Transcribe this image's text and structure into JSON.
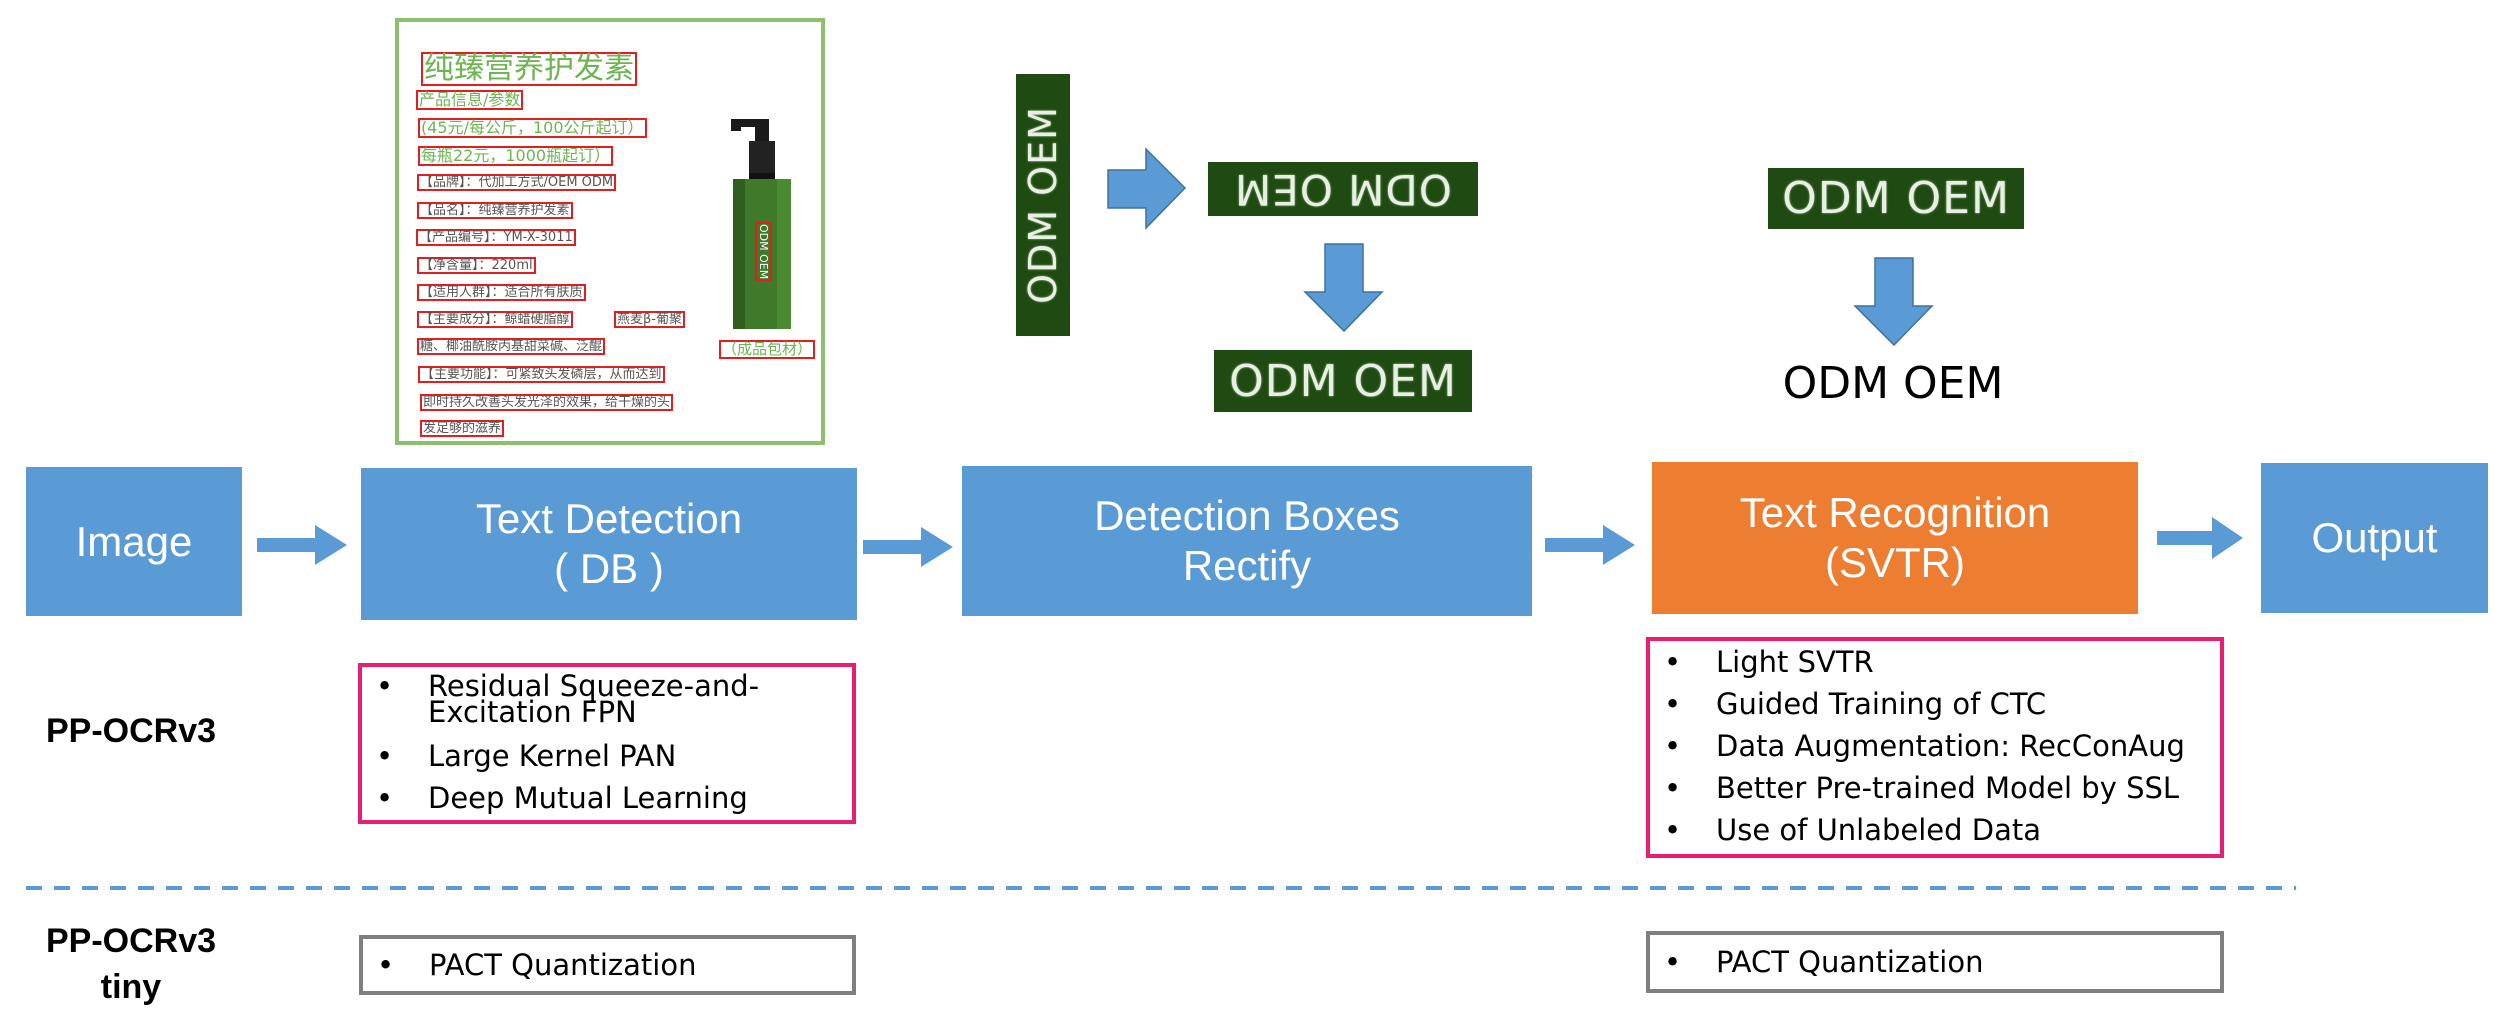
{
  "product_image": {
    "title": "纯臻营养护发素",
    "lines": [
      {
        "text": "产品信息/参数",
        "tone": "green"
      },
      {
        "text": "(45元/每公斤，100公斤起订）",
        "tone": "green"
      },
      {
        "text": "每瓶22元，1000瓶起订）",
        "tone": "green"
      },
      {
        "text": "【品牌】：代加工方式/OEM ODM",
        "tone": "grey"
      },
      {
        "text": "【品名】：纯臻营养护发素",
        "tone": "grey"
      },
      {
        "text": "【产品编号】：YM-X-3011",
        "tone": "grey"
      },
      {
        "text": "【净含量】：220ml",
        "tone": "grey"
      },
      {
        "text": "【适用人群】：适合所有肤质",
        "tone": "grey"
      },
      {
        "text": "【主要成分】：鲸蜡硬脂醇",
        "tone": "grey"
      },
      {
        "text": "燕麦β-葡聚",
        "tone": "grey"
      },
      {
        "text": "糖、椰油酰胺丙基甜菜碱、泛醌",
        "tone": "grey"
      },
      {
        "text": "【主要功能】：可紧致头发磷层，从而达到",
        "tone": "grey"
      },
      {
        "text": "即时持久改善头发光泽的效果，给干燥的头",
        "tone": "grey"
      },
      {
        "text": "发足够的滋养",
        "tone": "grey"
      }
    ],
    "bottle_label": "ODM OEM",
    "package_label": "（成品包材）"
  },
  "crops": {
    "rotated_vertical": "ODM OEM",
    "flipped": "ODM OEM",
    "rectified": "ODM OEM",
    "recognition_input": "ODM OEM",
    "recognition_output": "ODM OEM"
  },
  "pipeline": {
    "stages": [
      {
        "id": "image",
        "lines": [
          "Image"
        ],
        "color": "#5B9BD5"
      },
      {
        "id": "text-detection",
        "lines": [
          "Text Detection",
          "( DB )"
        ],
        "color": "#5B9BD5"
      },
      {
        "id": "detection-boxes-rectify",
        "lines": [
          "Detection Boxes",
          "Rectify"
        ],
        "color": "#5B9BD5"
      },
      {
        "id": "text-recognition",
        "lines": [
          "Text Recognition",
          "(SVTR)"
        ],
        "color": "#ED7D31"
      },
      {
        "id": "output",
        "lines": [
          "Output"
        ],
        "color": "#5B9BD5"
      }
    ]
  },
  "rows": {
    "ppocrv3": {
      "label": "PP-OCRv3",
      "detection_items": [
        "Residual Squeeze-and-Excitation FPN",
        "Large Kernel PAN",
        "Deep Mutual Learning"
      ],
      "recognition_items": [
        "Light SVTR",
        "Guided Training of CTC",
        "Data Augmentation: RecConAug",
        "Better Pre-trained Model by SSL",
        "Use of Unlabeled Data"
      ]
    },
    "ppocrv3_tiny": {
      "label_line1": "PP-OCRv3",
      "label_line2": "tiny",
      "detection_items": [
        "PACT Quantization"
      ],
      "recognition_items": [
        "PACT Quantization"
      ]
    }
  },
  "bullet_glyph": "•",
  "colors": {
    "stage_blue": "#5B9BD5",
    "stage_orange": "#ED7D31",
    "highlight_pink": "#E91E73",
    "box_grey": "#7F7F7F",
    "crop_green": "#1F4A12"
  }
}
